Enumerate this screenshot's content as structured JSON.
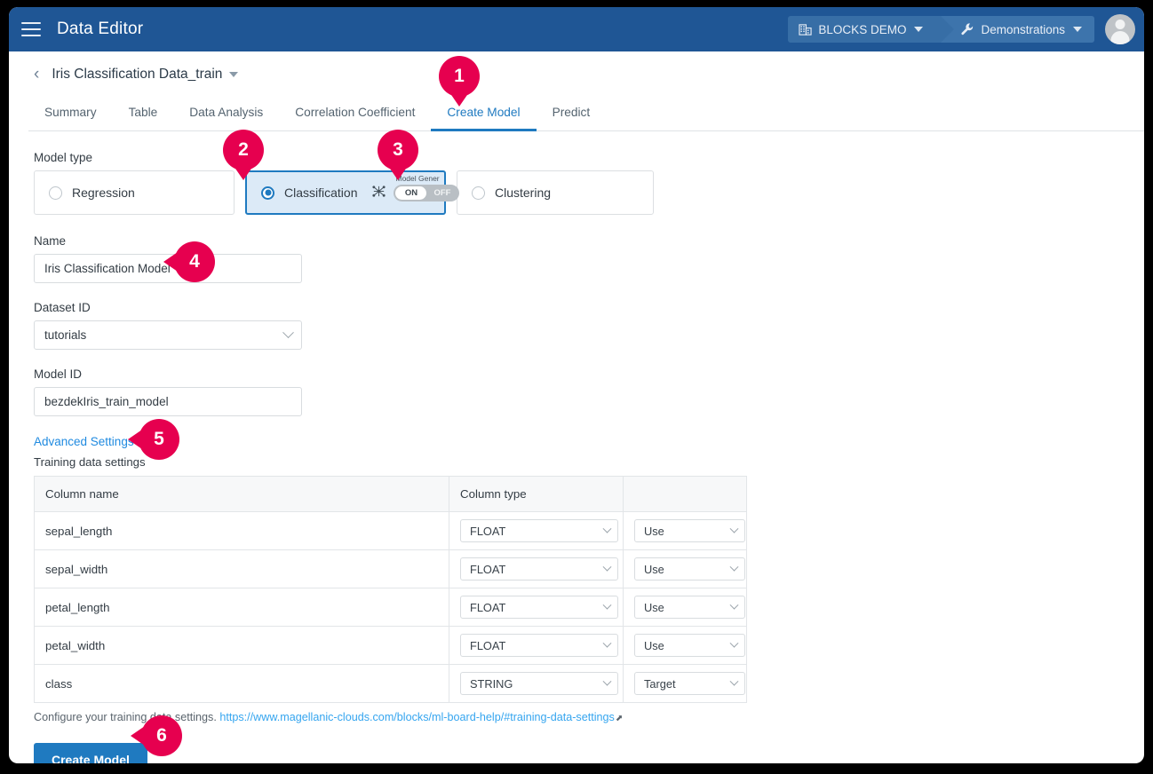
{
  "topbar": {
    "menu_icon": "hamburger-icon",
    "app_title": "Data Editor",
    "breadcrumbs": [
      {
        "icon": "building-icon",
        "label": "BLOCKS DEMO"
      },
      {
        "icon": "wrench-icon",
        "label": "Demonstrations"
      }
    ],
    "avatar": "user-avatar"
  },
  "page": {
    "back_icon": "chevron-left-icon",
    "doc_title": "Iris Classification Data_train",
    "tabs": [
      {
        "label": "Summary",
        "active": false
      },
      {
        "label": "Table",
        "active": false
      },
      {
        "label": "Data Analysis",
        "active": false
      },
      {
        "label": "Correlation Coefficient",
        "active": false
      },
      {
        "label": "Create Model",
        "active": true
      },
      {
        "label": "Predict",
        "active": false
      }
    ]
  },
  "form": {
    "model_type_label": "Model type",
    "model_types": [
      {
        "label": "Regression",
        "selected": false
      },
      {
        "label": "Classification",
        "selected": true
      },
      {
        "label": "Clustering",
        "selected": false
      }
    ],
    "model_generation": {
      "icon": "model-generation-icon",
      "label": "Model Gener",
      "on_label": "ON",
      "off_label": "OFF",
      "state": "OFF"
    },
    "name_label": "Name",
    "name_value": "Iris Classification Model",
    "dataset_id_label": "Dataset ID",
    "dataset_id_value": "tutorials",
    "model_id_label": "Model ID",
    "model_id_value": "bezdekIris_train_model",
    "advanced_settings_label": "Advanced Settings",
    "training_data_settings_label": "Training data settings"
  },
  "table": {
    "headers": [
      "Column name",
      "Column type",
      ""
    ],
    "rows": [
      {
        "name": "sepal_length",
        "type": "FLOAT",
        "usage": "Use"
      },
      {
        "name": "sepal_width",
        "type": "FLOAT",
        "usage": "Use"
      },
      {
        "name": "petal_length",
        "type": "FLOAT",
        "usage": "Use"
      },
      {
        "name": "petal_width",
        "type": "FLOAT",
        "usage": "Use"
      },
      {
        "name": "class",
        "type": "STRING",
        "usage": "Target"
      }
    ]
  },
  "note": {
    "text": "Configure your training data settings.",
    "link": "https://www.magellanic-clouds.com/blocks/ml-board-help/#training-data-settings",
    "link_icon": "external-link-icon"
  },
  "actions": {
    "create_model_label": "Create Model"
  },
  "markers": [
    {
      "num": "1"
    },
    {
      "num": "2"
    },
    {
      "num": "3"
    },
    {
      "num": "4"
    },
    {
      "num": "5"
    },
    {
      "num": "6"
    }
  ],
  "colors": {
    "header_blue": "#1f5695",
    "accent_blue": "#1f7ac0",
    "link_blue": "#35a5ef",
    "marker_pink": "#e6004f",
    "selected_card_bg": "#dceaf7"
  }
}
